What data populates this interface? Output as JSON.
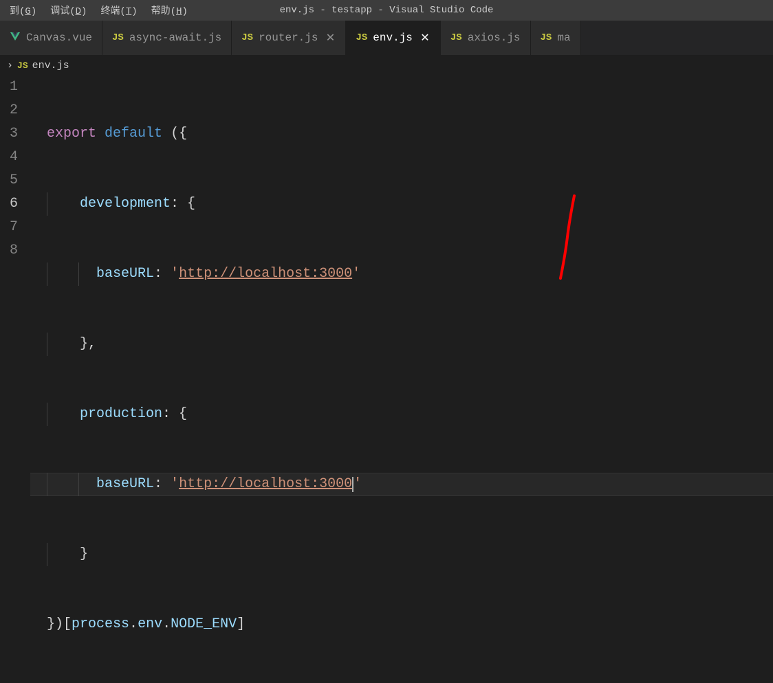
{
  "menubar": {
    "items": [
      {
        "pre": "到(",
        "key": "G",
        "post": ")"
      },
      {
        "pre": "调试(",
        "key": "D",
        "post": ")"
      },
      {
        "pre": "终端(",
        "key": "T",
        "post": ")"
      },
      {
        "pre": "帮助(",
        "key": "H",
        "post": ")"
      }
    ],
    "title": "env.js - testapp - Visual Studio Code"
  },
  "tabs": [
    {
      "iconType": "vue",
      "label": "Canvas.vue",
      "closable": false,
      "active": false
    },
    {
      "iconType": "js",
      "label": "async-await.js",
      "closable": false,
      "active": false
    },
    {
      "iconType": "js",
      "label": "router.js",
      "closable": true,
      "active": false
    },
    {
      "iconType": "js",
      "label": "env.js",
      "closable": true,
      "active": true
    },
    {
      "iconType": "js",
      "label": "axios.js",
      "closable": false,
      "active": false
    },
    {
      "iconType": "js",
      "label": "ma",
      "closable": false,
      "active": false
    }
  ],
  "breadcrumb": {
    "iconLabel": "JS",
    "file": "env.js"
  },
  "code": {
    "line1": {
      "export": "export",
      "default": "default",
      "rest": " ({"
    },
    "line2": {
      "prop": "development",
      "rest": ": {"
    },
    "line3": {
      "prop": "baseURL",
      "colon": ": ",
      "q1": "'",
      "url": "http://localhost:3000",
      "q2": "'"
    },
    "line4": {
      "text": "},"
    },
    "line5": {
      "prop": "production",
      "rest": ": {"
    },
    "line6": {
      "prop": "baseURL",
      "colon": ": ",
      "q1": "'",
      "url": "http://localhost:3000",
      "q2": "'"
    },
    "line7": {
      "text": "}"
    },
    "line8": {
      "pre": "})[",
      "v1": "process",
      "d1": ".",
      "v2": "env",
      "d2": ".",
      "v3": "NODE_ENV",
      "post": "]"
    }
  },
  "lineNumbers": [
    "1",
    "2",
    "3",
    "4",
    "5",
    "6",
    "7",
    "8"
  ],
  "icons": {
    "js": "JS",
    "close": "✕",
    "chevron": "›"
  }
}
